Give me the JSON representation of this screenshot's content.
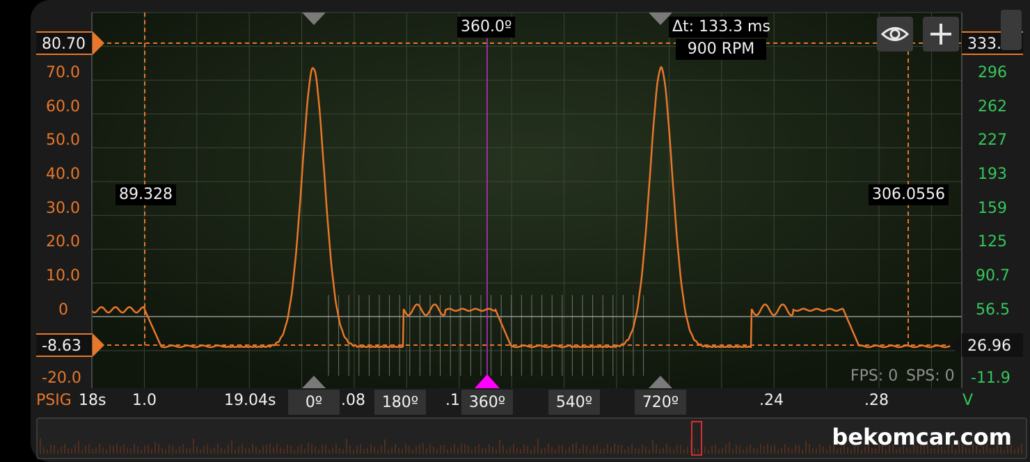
{
  "scope": {
    "channel_name": "PSIG",
    "left_axis": {
      "top_marker": "80.70",
      "bottom_marker": "-8.63",
      "ticks": [
        "70.0",
        "60.0",
        "50.0",
        "40.0",
        "30.0",
        "20.0",
        "10.0",
        "0",
        "-20.0"
      ]
    },
    "right_axis": {
      "top_marker": "333.0",
      "bottom_marker": "26.96",
      "ticks": [
        "296",
        "262",
        "227",
        "193",
        "159",
        "125",
        "90.7",
        "56.5",
        "-11.9"
      ],
      "unit": "V"
    },
    "time_axis": {
      "window": "18s",
      "labels": [
        "1.0",
        "19.04s",
        ".08",
        ".1",
        ".24",
        ".28"
      ]
    },
    "phase_markers": [
      "0º",
      "180º",
      "360º",
      "540º",
      "720º"
    ],
    "cursor_angle": "360.0º",
    "cursor_left_value": "89.328",
    "cursor_right_value": "306.0556",
    "delta": {
      "time": "Δt: 133.3 ms",
      "rpm": "900 RPM"
    },
    "status": {
      "fps": "FPS: 0",
      "sps": "SPS: 0"
    },
    "buttons": {
      "visibility_icon": "eye-icon",
      "add_icon": "plus-icon"
    },
    "colors": {
      "trace": "#e8772a",
      "right_axis": "#35c75a",
      "cursor": "#ff00ff"
    }
  },
  "watermark": "bekomcar.com"
}
